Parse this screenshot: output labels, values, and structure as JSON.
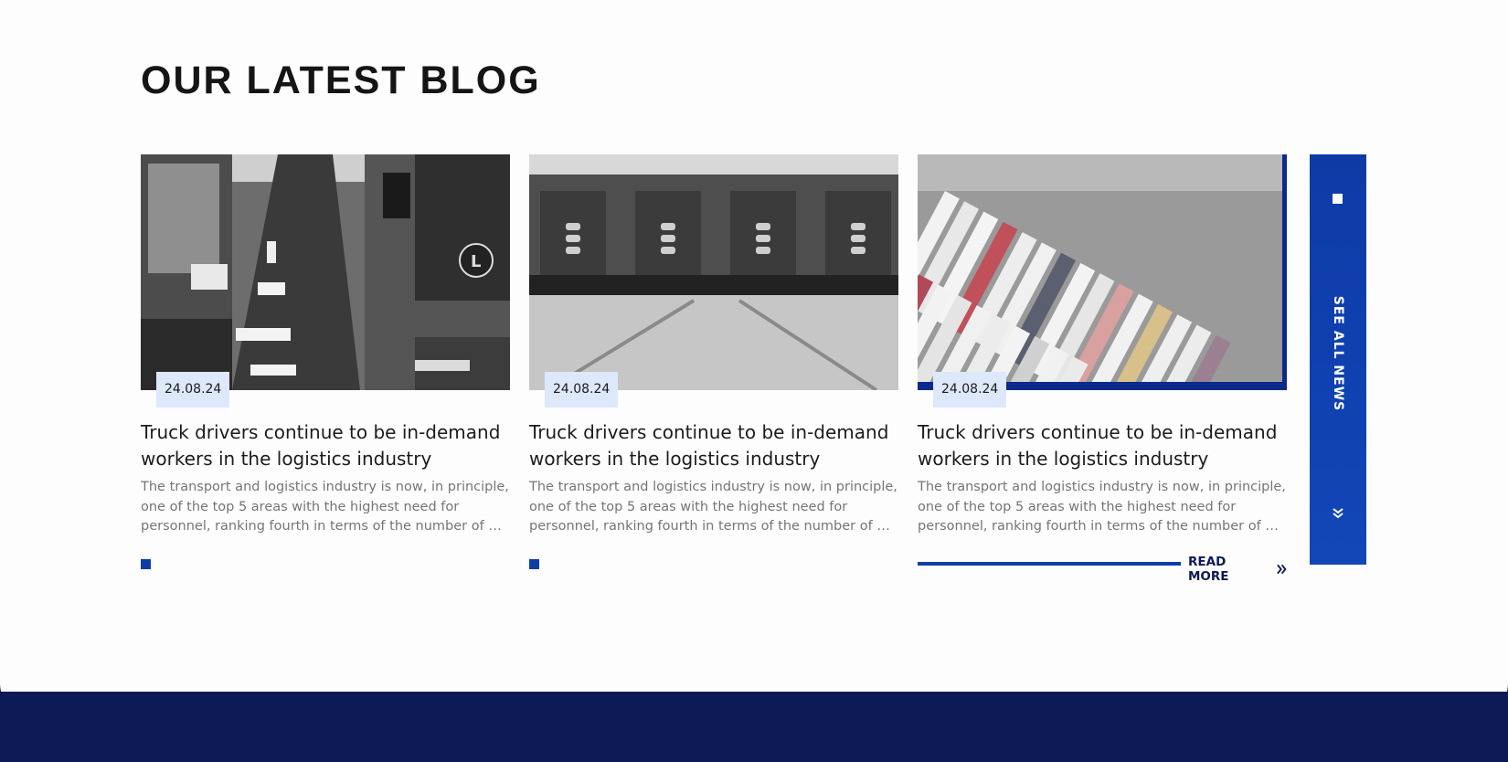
{
  "section": {
    "title": "OUR LATEST BLOG"
  },
  "posts": [
    {
      "date": "24.08.24",
      "headline": "Truck drivers continue to be in-demand workers in the logistics industry",
      "excerpt_lines": [
        "The transport and logistics industry is now, in principle,",
        "one of the top 5 areas with the highest need for",
        "personnel, ranking fourth in terms of the number of pos…"
      ],
      "image_icon": "truck-street-photo"
    },
    {
      "date": "24.08.24",
      "headline": "Truck drivers continue to be in-demand workers in the logistics industry",
      "excerpt_lines": [
        "The transport and logistics industry is now, in principle,",
        "one of the top 5 areas with the highest need for",
        "personnel, ranking fourth in terms of the number of pos…"
      ],
      "image_icon": "warehouse-docks-photo"
    },
    {
      "date": "24.08.24",
      "headline": "Truck drivers continue to be in-demand workers in the logistics industry",
      "excerpt_lines": [
        "The transport and logistics industry is now, in principle,",
        "one of the top 5 areas with the highest need for",
        "personnel, ranking fourth in terms of the number of pos…"
      ],
      "image_icon": "truck-parking-aerial-photo",
      "read_more_label": "READ MORE",
      "active": true
    }
  ],
  "see_all": {
    "label": "SEE ALL NEWS"
  },
  "colors": {
    "accent": "#0c3ea6",
    "navy": "#0e1a55",
    "date_badge": "#dde8fa"
  }
}
